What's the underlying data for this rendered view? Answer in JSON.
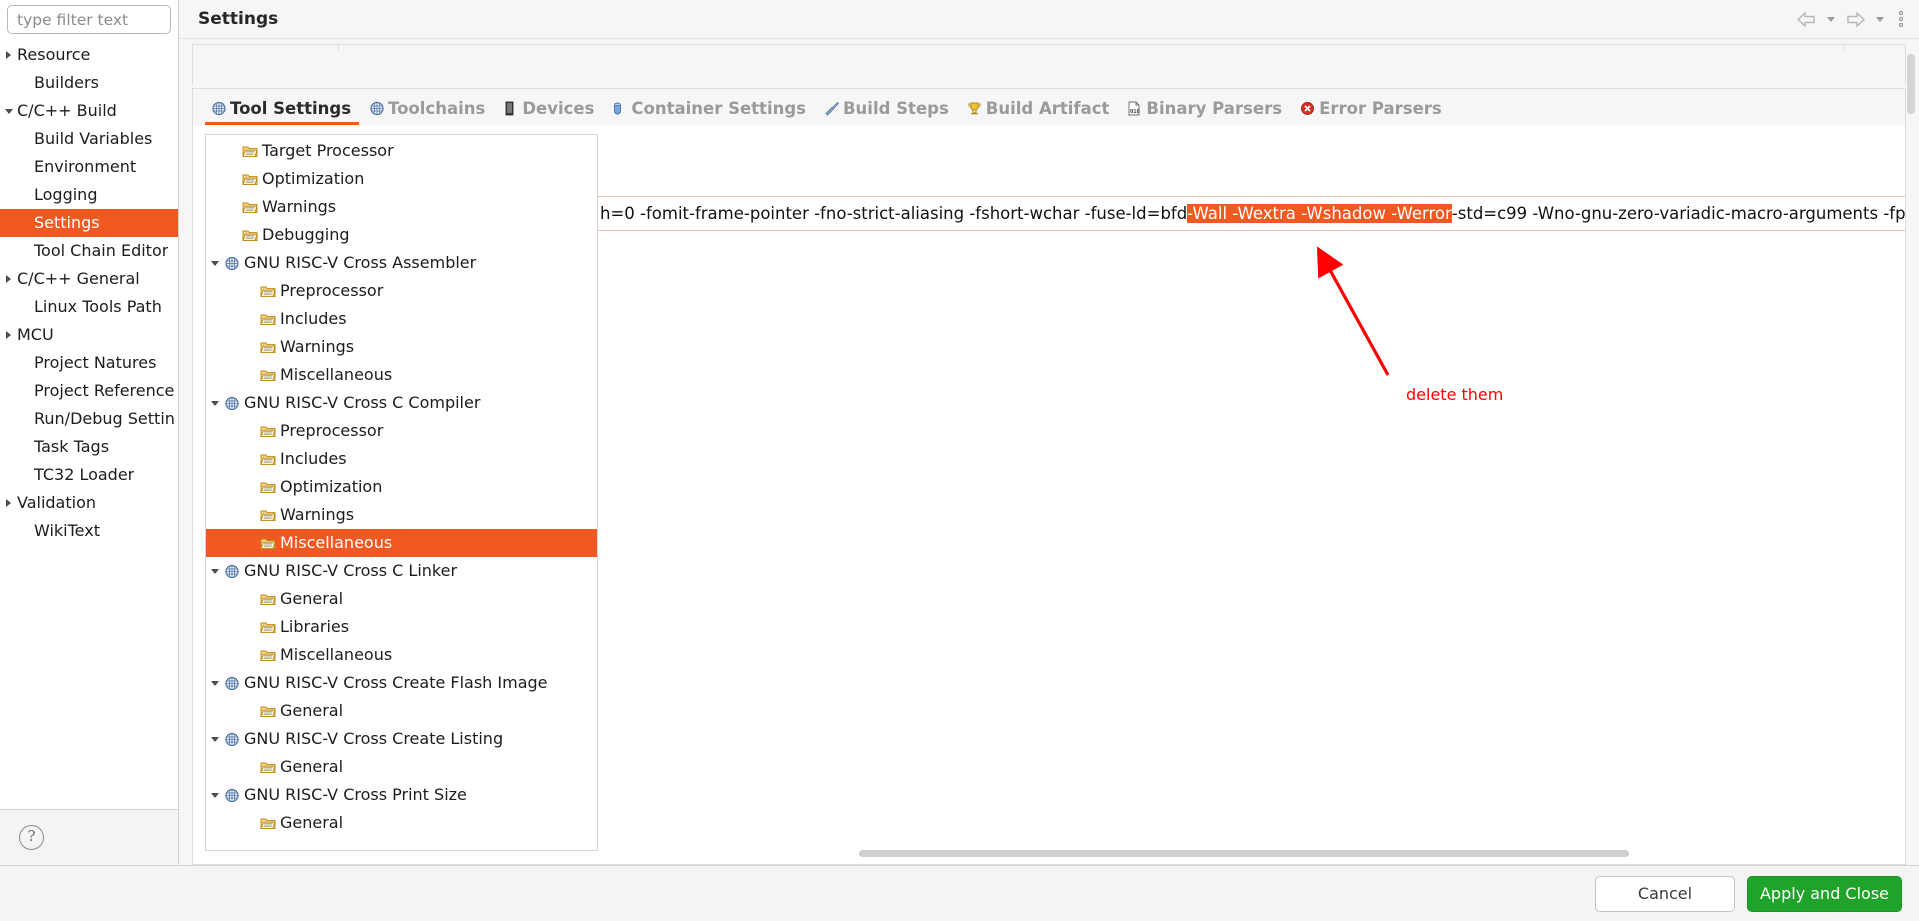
{
  "window": {
    "title": "Settings"
  },
  "header": {
    "title": "Settings",
    "back_icon": "back-arrow-icon",
    "back_dropdown_icon": "chevron-down-icon",
    "forward_icon": "forward-arrow-icon",
    "forward_dropdown_icon": "chevron-down-icon",
    "menu_icon": "kebab-menu-icon"
  },
  "sidebar": {
    "filter": {
      "value": "",
      "placeholder": "type filter text"
    },
    "help_icon": "help-question-icon",
    "items": [
      {
        "label": "Resource",
        "indent": 0,
        "expander": "collapsed",
        "selected": false
      },
      {
        "label": "Builders",
        "indent": 1,
        "expander": "none",
        "selected": false
      },
      {
        "label": "C/C++ Build",
        "indent": 0,
        "expander": "expanded",
        "selected": false
      },
      {
        "label": "Build Variables",
        "indent": 1,
        "expander": "none",
        "selected": false
      },
      {
        "label": "Environment",
        "indent": 1,
        "expander": "none",
        "selected": false
      },
      {
        "label": "Logging",
        "indent": 1,
        "expander": "none",
        "selected": false
      },
      {
        "label": "Settings",
        "indent": 1,
        "expander": "none",
        "selected": true
      },
      {
        "label": "Tool Chain Editor",
        "indent": 1,
        "expander": "none",
        "selected": false
      },
      {
        "label": "C/C++ General",
        "indent": 0,
        "expander": "collapsed",
        "selected": false
      },
      {
        "label": "Linux Tools Path",
        "indent": 1,
        "expander": "none",
        "selected": false
      },
      {
        "label": "MCU",
        "indent": 0,
        "expander": "collapsed",
        "selected": false
      },
      {
        "label": "Project Natures",
        "indent": 1,
        "expander": "none",
        "selected": false
      },
      {
        "label": "Project References",
        "indent": 1,
        "expander": "none",
        "selected": false
      },
      {
        "label": "Run/Debug Settings",
        "indent": 1,
        "expander": "none",
        "selected": false
      },
      {
        "label": "Task Tags",
        "indent": 1,
        "expander": "none",
        "selected": false
      },
      {
        "label": "TC32 Loader",
        "indent": 1,
        "expander": "none",
        "selected": false
      },
      {
        "label": "Validation",
        "indent": 0,
        "expander": "collapsed",
        "selected": false
      },
      {
        "label": "WikiText",
        "indent": 1,
        "expander": "none",
        "selected": false
      }
    ]
  },
  "tabs": [
    {
      "label": "Tool Settings",
      "icon": "tool-settings-icon",
      "active": true
    },
    {
      "label": "Toolchains",
      "icon": "toolchains-icon",
      "active": false
    },
    {
      "label": "Devices",
      "icon": "devices-icon",
      "active": false
    },
    {
      "label": "Container Settings",
      "icon": "container-icon",
      "active": false
    },
    {
      "label": "Build Steps",
      "icon": "build-steps-icon",
      "active": false
    },
    {
      "label": "Build Artifact",
      "icon": "build-artifact-icon",
      "active": false
    },
    {
      "label": "Binary Parsers",
      "icon": "binary-parsers-icon",
      "active": false
    },
    {
      "label": "Error Parsers",
      "icon": "error-parsers-icon",
      "active": false
    }
  ],
  "tool_tree": [
    {
      "label": "Target Processor",
      "level": 1,
      "expander": "none",
      "icon": "folder-icon",
      "selected": false
    },
    {
      "label": "Optimization",
      "level": 1,
      "expander": "none",
      "icon": "folder-icon",
      "selected": false
    },
    {
      "label": "Warnings",
      "level": 1,
      "expander": "none",
      "icon": "folder-icon",
      "selected": false
    },
    {
      "label": "Debugging",
      "level": 1,
      "expander": "none",
      "icon": "folder-icon",
      "selected": false
    },
    {
      "label": "GNU RISC-V Cross Assembler",
      "level": 0,
      "expander": "expanded",
      "icon": "tool-icon",
      "selected": false
    },
    {
      "label": "Preprocessor",
      "level": 2,
      "expander": "none",
      "icon": "folder-icon",
      "selected": false
    },
    {
      "label": "Includes",
      "level": 2,
      "expander": "none",
      "icon": "folder-icon",
      "selected": false
    },
    {
      "label": "Warnings",
      "level": 2,
      "expander": "none",
      "icon": "folder-icon",
      "selected": false
    },
    {
      "label": "Miscellaneous",
      "level": 2,
      "expander": "none",
      "icon": "folder-icon",
      "selected": false
    },
    {
      "label": "GNU RISC-V Cross C Compiler",
      "level": 0,
      "expander": "expanded",
      "icon": "tool-icon",
      "selected": false
    },
    {
      "label": "Preprocessor",
      "level": 2,
      "expander": "none",
      "icon": "folder-icon",
      "selected": false
    },
    {
      "label": "Includes",
      "level": 2,
      "expander": "none",
      "icon": "folder-icon",
      "selected": false
    },
    {
      "label": "Optimization",
      "level": 2,
      "expander": "none",
      "icon": "folder-icon",
      "selected": false
    },
    {
      "label": "Warnings",
      "level": 2,
      "expander": "none",
      "icon": "folder-icon",
      "selected": false
    },
    {
      "label": "Miscellaneous",
      "level": 2,
      "expander": "none",
      "icon": "folder-icon",
      "selected": true
    },
    {
      "label": "GNU RISC-V Cross C Linker",
      "level": 0,
      "expander": "expanded",
      "icon": "tool-icon",
      "selected": false
    },
    {
      "label": "General",
      "level": 2,
      "expander": "none",
      "icon": "folder-icon",
      "selected": false
    },
    {
      "label": "Libraries",
      "level": 2,
      "expander": "none",
      "icon": "folder-icon",
      "selected": false
    },
    {
      "label": "Miscellaneous",
      "level": 2,
      "expander": "none",
      "icon": "folder-icon",
      "selected": false
    },
    {
      "label": "GNU RISC-V Cross Create Flash Image",
      "level": 0,
      "expander": "expanded",
      "icon": "tool-icon",
      "selected": false
    },
    {
      "label": "General",
      "level": 2,
      "expander": "none",
      "icon": "folder-icon",
      "selected": false
    },
    {
      "label": "GNU RISC-V Cross Create Listing",
      "level": 0,
      "expander": "expanded",
      "icon": "tool-icon",
      "selected": false
    },
    {
      "label": "General",
      "level": 2,
      "expander": "none",
      "icon": "folder-icon",
      "selected": false
    },
    {
      "label": "GNU RISC-V Cross Print Size",
      "level": 0,
      "expander": "expanded",
      "icon": "tool-icon",
      "selected": false
    },
    {
      "label": "General",
      "level": 2,
      "expander": "none",
      "icon": "folder-icon",
      "selected": false
    }
  ],
  "flags_field": {
    "text_before": "h=0  -fomit-frame-pointer -fno-strict-aliasing -fshort-wchar -fuse-ld=bfd",
    "selected_text": "-Wall -Wextra -Wshadow -Werror",
    "text_after": "-std=c99 -Wno-gnu-zero-variadic-macro-arguments -fp"
  },
  "annotation": {
    "text": "delete them",
    "color": "#ff0000",
    "arrow": "red-arrow-pointing-up-left"
  },
  "footer": {
    "cancel_label": "Cancel",
    "apply_close_label": "Apply and Close"
  },
  "colors": {
    "selection": "#f05a22",
    "apply_button": "#1fa32a",
    "annotation": "#ff0000"
  }
}
